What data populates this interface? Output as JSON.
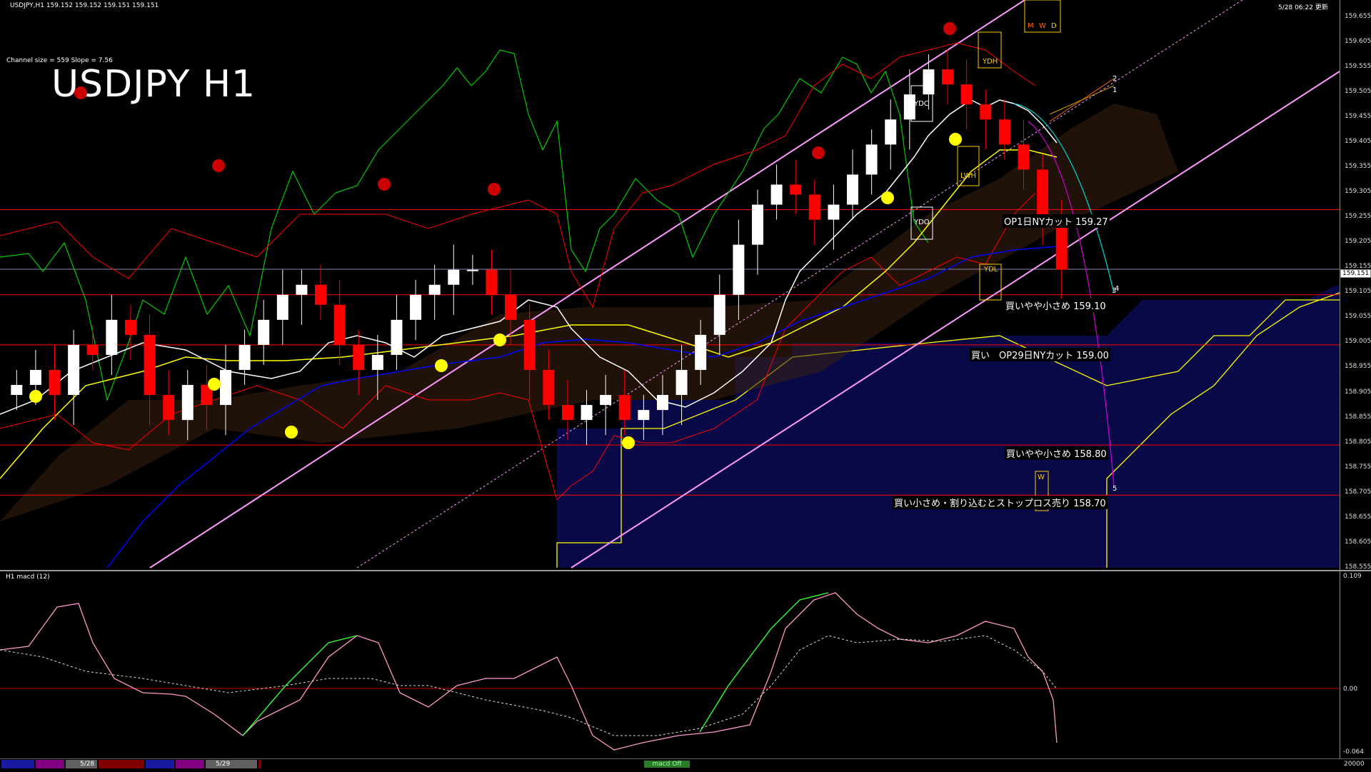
{
  "header": {
    "symbol_line": "USDJPY,H1  159.152 159.152 159.151 159.151",
    "datetime": "5/28 06:22 更新",
    "channel_info": "Channel size = 559 Slope = 7.56",
    "big_title": "USDJPY H1"
  },
  "price_axis": {
    "ticks": [
      "159.655",
      "159.605",
      "159.555",
      "159.505",
      "159.455",
      "159.405",
      "159.355",
      "159.305",
      "159.255",
      "159.205",
      "159.155",
      "159.105",
      "159.055",
      "159.005",
      "158.955",
      "158.905",
      "158.855",
      "158.805",
      "158.755",
      "158.705",
      "158.655",
      "158.605",
      "158.555"
    ],
    "current_price": "159.151"
  },
  "levels": [
    {
      "label": "OP1日NYカット 159.27",
      "price": 159.27,
      "color": "#ff0000"
    },
    {
      "label": "買いやや小さめ 159.10",
      "price": 159.1,
      "color": "#ff0000"
    },
    {
      "label": "買い　OP29日NYカット 159.00",
      "price": 159.0,
      "color": "#ff0000"
    },
    {
      "label": "買いやや小さめ 158.80",
      "price": 158.8,
      "color": "#ff0000"
    },
    {
      "label": "買い小さめ・割り込むとストップロス売り 158.70",
      "price": 158.7,
      "color": "#ff0000"
    }
  ],
  "box_labels": {
    "ydh": "YDH",
    "ydc": "YDC",
    "ydo": "YDO",
    "ydl": "YDL",
    "lwh": "LWH",
    "m": "M",
    "w": "W",
    "d": "D",
    "w2": "W",
    "n1": "1",
    "n2": "2",
    "n3": "3",
    "n4": "4",
    "n5": "5"
  },
  "macd": {
    "title": "H1  macd (12)",
    "ticks": [
      "0.109",
      "0.00",
      "-0.064"
    ],
    "histogram_value": "20000"
  },
  "time_axis": {
    "labels": [
      "5/28",
      "5/29"
    ],
    "button": "macd Off"
  },
  "colors": {
    "bull": "#ffffff",
    "bear": "#ff0000",
    "sma_fast": "#ffffff",
    "sma_mid": "#ffff00",
    "sma_slow": "#0000ff",
    "bollinger": "#ff0000",
    "chikou": "#00cc00",
    "channel": "#ff99ff",
    "kumo_bull": "#8888ff",
    "kumo_bear": "#cc9966",
    "macd_green": "#00ff00",
    "macd_pink": "#ff99cc"
  },
  "chart_data": {
    "type": "candlestick",
    "title": "USDJPY H1",
    "ylim": [
      158.555,
      159.68
    ],
    "levels": [
      159.27,
      159.1,
      159.0,
      158.8,
      158.7
    ],
    "current": 159.151,
    "close_trend": [
      158.92,
      158.95,
      158.9,
      159.0,
      158.98,
      159.05,
      159.02,
      158.9,
      158.85,
      158.92,
      158.88,
      158.95,
      159.0,
      159.05,
      159.1,
      159.12,
      159.08,
      159.0,
      158.95,
      158.98,
      159.05,
      159.1,
      159.12,
      159.15,
      159.15,
      159.1,
      159.05,
      158.95,
      158.88,
      158.85,
      158.88,
      158.9,
      158.85,
      158.87,
      158.9,
      158.95,
      159.02,
      159.1,
      159.2,
      159.28,
      159.32,
      159.3,
      159.25,
      159.28,
      159.34,
      159.4,
      159.45,
      159.5,
      159.55,
      159.52,
      159.48,
      159.45,
      159.4,
      159.35,
      159.25,
      159.15
    ]
  }
}
